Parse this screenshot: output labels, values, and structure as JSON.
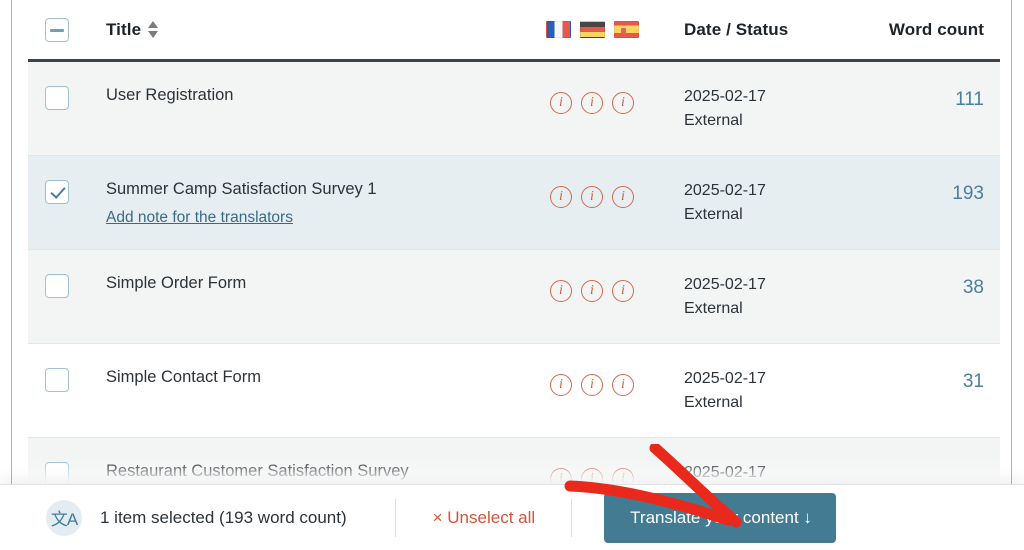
{
  "table": {
    "header": {
      "select_all_state": "indeterminate",
      "title_label": "Title",
      "sort_icon": "sort-arrows-icon",
      "languages": [
        {
          "code": "fr",
          "name": "french-flag"
        },
        {
          "code": "de",
          "name": "german-flag"
        },
        {
          "code": "es",
          "name": "spanish-flag"
        }
      ],
      "date_status_label": "Date / Status",
      "word_count_label": "Word count"
    },
    "rows": [
      {
        "checked": false,
        "title": "User Registration",
        "note_link": "",
        "translations": [
          "i",
          "i",
          "i"
        ],
        "date": "2025-02-17",
        "status": "External",
        "word_count": "111",
        "background": "alt"
      },
      {
        "checked": true,
        "title": "Summer Camp Satisfaction Survey 1",
        "note_link": "Add note for the translators",
        "translations": [
          "i",
          "i",
          "i"
        ],
        "date": "2025-02-17",
        "status": "External",
        "word_count": "193",
        "background": "selected"
      },
      {
        "checked": false,
        "title": "Simple Order Form",
        "note_link": "",
        "translations": [
          "i",
          "i",
          "i"
        ],
        "date": "2025-02-17",
        "status": "External",
        "word_count": "38",
        "background": "alt"
      },
      {
        "checked": false,
        "title": "Simple Contact Form",
        "note_link": "",
        "translations": [
          "i",
          "i",
          "i"
        ],
        "date": "2025-02-17",
        "status": "External",
        "word_count": "31",
        "background": "plain"
      },
      {
        "checked": false,
        "title": "Restaurant Customer Satisfaction Survey",
        "note_link": "",
        "translations": [
          "i",
          "i",
          "i"
        ],
        "date": "2025-02-17",
        "status": "",
        "word_count": "",
        "background": "alt"
      }
    ]
  },
  "bottom_bar": {
    "icon": "translate-icon",
    "icon_glyph": "文A",
    "selection_summary": "1 item selected (193 word count)",
    "unselect_all": "× Unselect all",
    "translate_button": "Translate your content ↓"
  },
  "annotation": {
    "arrow": "red-arrow-pointing-to-translate-button",
    "color": "#e8291c"
  },
  "colors": {
    "accent_button": "#427b92",
    "link": "#3a6b85",
    "word_count": "#4b7f98",
    "unselect": "#d4533a",
    "info_icon": "#c9623f",
    "selected_row": "#e7eef2",
    "alt_row": "#f3f4f4",
    "header_rule": "#3c434a"
  }
}
